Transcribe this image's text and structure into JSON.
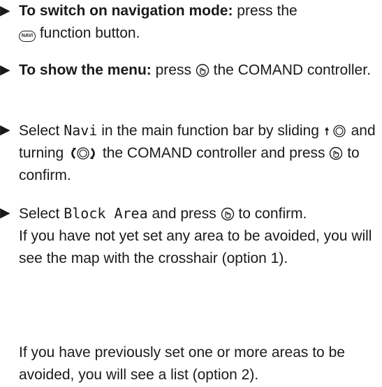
{
  "steps": [
    {
      "bullet": "▶",
      "lead": "To switch on navigation mode:",
      "text_1": "press the",
      "navi_label": "NAVI",
      "text_2": "function button."
    },
    {
      "bullet": "▶",
      "lead": "To show the menu:",
      "text_1": "press",
      "text_2": "the COMAND controller."
    },
    {
      "bullet": "▶",
      "text_1": "Select",
      "menu_item": "Navi",
      "text_2": "in the main function bar by sliding",
      "text_3": "and turning",
      "text_4": "the COMAND controller and press",
      "text_5": "to confirm."
    },
    {
      "bullet": "▶",
      "text_1": "Select",
      "menu_item": "Block Area",
      "text_2": "and press",
      "text_3": "to confirm.",
      "note_1": "If you have not yet set any area to be avoided, you will see the map with the crosshair (option 1).",
      "note_2": "If you have previously set one or more areas to be avoided, you will see a list (option 2)."
    }
  ],
  "icons": {
    "navi_button": "navi-function-button-icon",
    "press": "controller-press-icon",
    "slide_up": "controller-slide-up-icon",
    "turn": "controller-turn-icon"
  }
}
